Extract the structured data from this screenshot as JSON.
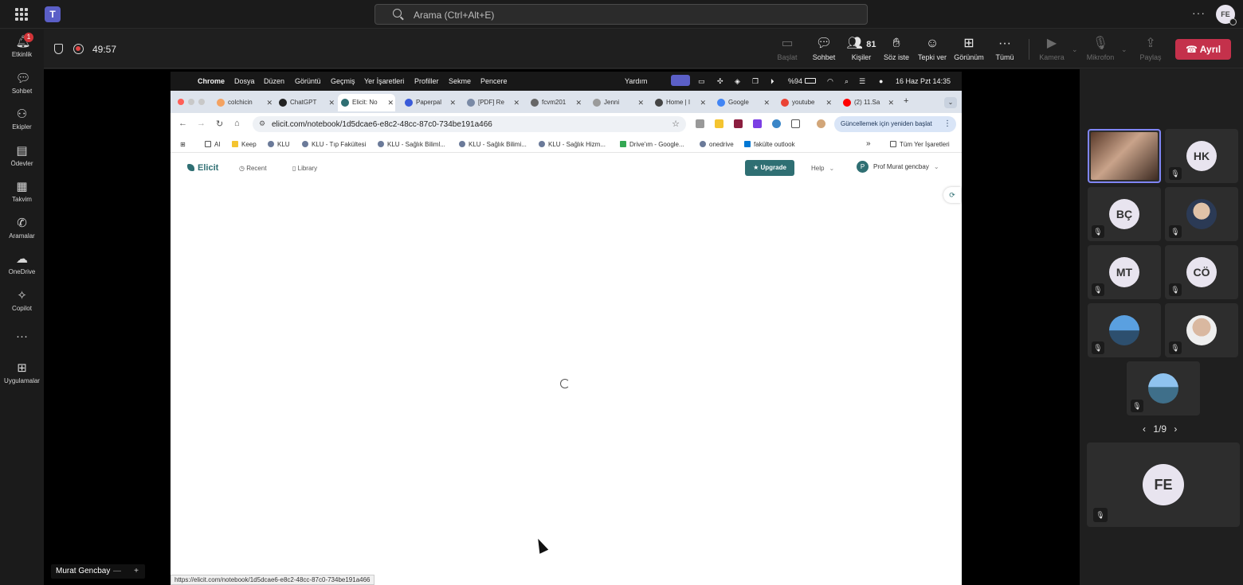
{
  "topbar": {
    "search_placeholder": "Arama (Ctrl+Alt+E)",
    "more": "···",
    "avatar_initials": "FE"
  },
  "rail": {
    "items": [
      {
        "label": "Etkinlik",
        "icon": "bell-icon",
        "badge": "1"
      },
      {
        "label": "Sohbet",
        "icon": "chat-icon"
      },
      {
        "label": "Ekipler",
        "icon": "teams-icon"
      },
      {
        "label": "Ödevler",
        "icon": "assignments-icon"
      },
      {
        "label": "Takvim",
        "icon": "calendar-icon"
      },
      {
        "label": "Aramalar",
        "icon": "phone-icon"
      },
      {
        "label": "OneDrive",
        "icon": "cloud-icon"
      },
      {
        "label": "Copilot",
        "icon": "copilot-icon"
      },
      {
        "label": "···",
        "icon": "more-icon"
      },
      {
        "label": "Uygulamalar",
        "icon": "apps-icon"
      }
    ]
  },
  "meeting": {
    "timer": "49:57",
    "tools": {
      "share": "Başlat",
      "chat": "Sohbet",
      "people": "Kişiler",
      "people_count": "81",
      "raise": "Söz iste",
      "react": "Tepki ver",
      "view": "Görünüm",
      "more": "Tümü",
      "camera": "Kamera",
      "mic": "Mikrofon",
      "share_content": "Paylaş"
    },
    "leave_label": "Ayrıl"
  },
  "mac_menu": {
    "app": "Chrome",
    "items": [
      "Dosya",
      "Düzen",
      "Görüntü",
      "Geçmiş",
      "Yer İşaretleri",
      "Profiller",
      "Sekme",
      "Pencere",
      "Yardım"
    ],
    "battery": "%94",
    "datetime": "16 Haz Pzt  14:35"
  },
  "browser": {
    "tabs": [
      "colchicin",
      "ChatGPT",
      "Elicit: No",
      "Paperpal",
      "[PDF] Re",
      "fcvm201",
      "Jenni",
      "Home | I",
      "Google",
      "youtube",
      "(2) 11.Sa"
    ],
    "new_tab": "+",
    "url": "elicit.com/notebook/1d5dcae6-e8c2-48cc-87c0-734be191a466",
    "update_button": "Güncellemek için yeniden başlat",
    "bookmarks": [
      "AI",
      "Keep",
      "KLU",
      "KLU - Tıp Fakültesi",
      "KLU - Sağlık Biliml...",
      "KLU - Sağlık Bilimi...",
      "KLU - Sağlık Hizm...",
      "Drive'ım - Google...",
      "onedrive",
      "fakülte outlook"
    ],
    "bookmarks_overflow": "»",
    "all_bookmarks": "Tüm Yer İşaretleri",
    "status_url": "https://elicit.com/notebook/1d5dcae6-e8c2-48cc-87c0-734be191a466"
  },
  "elicit": {
    "logo": "Elicit",
    "recent": "Recent",
    "library": "Library",
    "upgrade": "★ Upgrade",
    "help": "Help",
    "user_initial": "P",
    "user_name": "Prof Murat gencbay"
  },
  "presenter": {
    "name": "Murat Gencbay",
    "dash": "—",
    "plus": "+"
  },
  "participants": [
    {
      "initials": "",
      "photo": true,
      "active": true
    },
    {
      "initials": "HK",
      "photo": false
    },
    {
      "initials": "BÇ",
      "photo": false
    },
    {
      "initials": "",
      "photo": true
    },
    {
      "initials": "MT",
      "photo": false
    },
    {
      "initials": "CÖ",
      "photo": false
    },
    {
      "initials": "",
      "photo": true
    },
    {
      "initials": "",
      "photo": true
    },
    {
      "initials": "",
      "photo": true
    }
  ],
  "pager": "1/9",
  "self": {
    "initials": "FE"
  },
  "colors": {
    "accent": "#5b5fc7",
    "leave": "#c4314b",
    "elicit": "#2f6f73"
  }
}
